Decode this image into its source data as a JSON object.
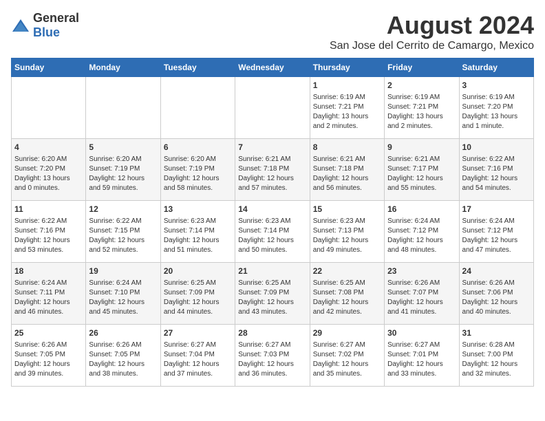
{
  "header": {
    "logo_general": "General",
    "logo_blue": "Blue",
    "month_title": "August 2024",
    "subtitle": "San Jose del Cerrito de Camargo, Mexico"
  },
  "days_of_week": [
    "Sunday",
    "Monday",
    "Tuesday",
    "Wednesday",
    "Thursday",
    "Friday",
    "Saturday"
  ],
  "weeks": [
    [
      {
        "day": "",
        "info": ""
      },
      {
        "day": "",
        "info": ""
      },
      {
        "day": "",
        "info": ""
      },
      {
        "day": "",
        "info": ""
      },
      {
        "day": "1",
        "info": "Sunrise: 6:19 AM\nSunset: 7:21 PM\nDaylight: 13 hours\nand 2 minutes."
      },
      {
        "day": "2",
        "info": "Sunrise: 6:19 AM\nSunset: 7:21 PM\nDaylight: 13 hours\nand 2 minutes."
      },
      {
        "day": "3",
        "info": "Sunrise: 6:19 AM\nSunset: 7:20 PM\nDaylight: 13 hours\nand 1 minute."
      }
    ],
    [
      {
        "day": "4",
        "info": "Sunrise: 6:20 AM\nSunset: 7:20 PM\nDaylight: 13 hours\nand 0 minutes."
      },
      {
        "day": "5",
        "info": "Sunrise: 6:20 AM\nSunset: 7:19 PM\nDaylight: 12 hours\nand 59 minutes."
      },
      {
        "day": "6",
        "info": "Sunrise: 6:20 AM\nSunset: 7:19 PM\nDaylight: 12 hours\nand 58 minutes."
      },
      {
        "day": "7",
        "info": "Sunrise: 6:21 AM\nSunset: 7:18 PM\nDaylight: 12 hours\nand 57 minutes."
      },
      {
        "day": "8",
        "info": "Sunrise: 6:21 AM\nSunset: 7:18 PM\nDaylight: 12 hours\nand 56 minutes."
      },
      {
        "day": "9",
        "info": "Sunrise: 6:21 AM\nSunset: 7:17 PM\nDaylight: 12 hours\nand 55 minutes."
      },
      {
        "day": "10",
        "info": "Sunrise: 6:22 AM\nSunset: 7:16 PM\nDaylight: 12 hours\nand 54 minutes."
      }
    ],
    [
      {
        "day": "11",
        "info": "Sunrise: 6:22 AM\nSunset: 7:16 PM\nDaylight: 12 hours\nand 53 minutes."
      },
      {
        "day": "12",
        "info": "Sunrise: 6:22 AM\nSunset: 7:15 PM\nDaylight: 12 hours\nand 52 minutes."
      },
      {
        "day": "13",
        "info": "Sunrise: 6:23 AM\nSunset: 7:14 PM\nDaylight: 12 hours\nand 51 minutes."
      },
      {
        "day": "14",
        "info": "Sunrise: 6:23 AM\nSunset: 7:14 PM\nDaylight: 12 hours\nand 50 minutes."
      },
      {
        "day": "15",
        "info": "Sunrise: 6:23 AM\nSunset: 7:13 PM\nDaylight: 12 hours\nand 49 minutes."
      },
      {
        "day": "16",
        "info": "Sunrise: 6:24 AM\nSunset: 7:12 PM\nDaylight: 12 hours\nand 48 minutes."
      },
      {
        "day": "17",
        "info": "Sunrise: 6:24 AM\nSunset: 7:12 PM\nDaylight: 12 hours\nand 47 minutes."
      }
    ],
    [
      {
        "day": "18",
        "info": "Sunrise: 6:24 AM\nSunset: 7:11 PM\nDaylight: 12 hours\nand 46 minutes."
      },
      {
        "day": "19",
        "info": "Sunrise: 6:24 AM\nSunset: 7:10 PM\nDaylight: 12 hours\nand 45 minutes."
      },
      {
        "day": "20",
        "info": "Sunrise: 6:25 AM\nSunset: 7:09 PM\nDaylight: 12 hours\nand 44 minutes."
      },
      {
        "day": "21",
        "info": "Sunrise: 6:25 AM\nSunset: 7:09 PM\nDaylight: 12 hours\nand 43 minutes."
      },
      {
        "day": "22",
        "info": "Sunrise: 6:25 AM\nSunset: 7:08 PM\nDaylight: 12 hours\nand 42 minutes."
      },
      {
        "day": "23",
        "info": "Sunrise: 6:26 AM\nSunset: 7:07 PM\nDaylight: 12 hours\nand 41 minutes."
      },
      {
        "day": "24",
        "info": "Sunrise: 6:26 AM\nSunset: 7:06 PM\nDaylight: 12 hours\nand 40 minutes."
      }
    ],
    [
      {
        "day": "25",
        "info": "Sunrise: 6:26 AM\nSunset: 7:05 PM\nDaylight: 12 hours\nand 39 minutes."
      },
      {
        "day": "26",
        "info": "Sunrise: 6:26 AM\nSunset: 7:05 PM\nDaylight: 12 hours\nand 38 minutes."
      },
      {
        "day": "27",
        "info": "Sunrise: 6:27 AM\nSunset: 7:04 PM\nDaylight: 12 hours\nand 37 minutes."
      },
      {
        "day": "28",
        "info": "Sunrise: 6:27 AM\nSunset: 7:03 PM\nDaylight: 12 hours\nand 36 minutes."
      },
      {
        "day": "29",
        "info": "Sunrise: 6:27 AM\nSunset: 7:02 PM\nDaylight: 12 hours\nand 35 minutes."
      },
      {
        "day": "30",
        "info": "Sunrise: 6:27 AM\nSunset: 7:01 PM\nDaylight: 12 hours\nand 33 minutes."
      },
      {
        "day": "31",
        "info": "Sunrise: 6:28 AM\nSunset: 7:00 PM\nDaylight: 12 hours\nand 32 minutes."
      }
    ]
  ]
}
